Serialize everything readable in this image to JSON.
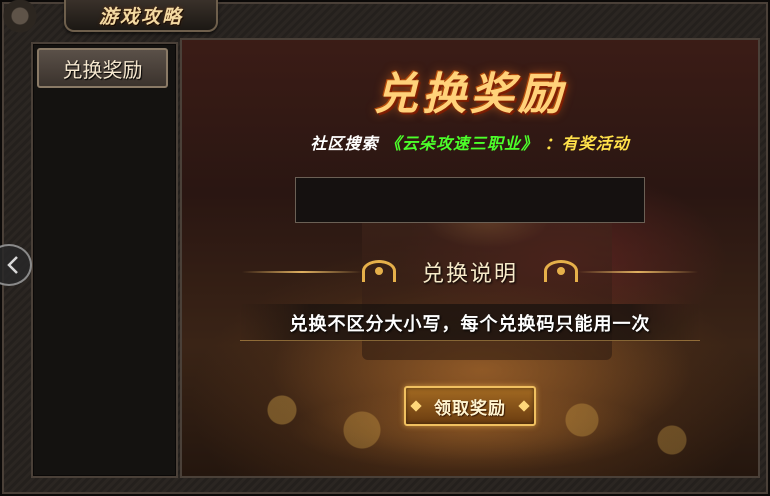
{
  "header": {
    "title": "游戏攻略"
  },
  "sidebar": {
    "tab_label": "兑换奖励"
  },
  "main": {
    "heading": "兑换奖励",
    "hint_prefix": "社区搜索",
    "hint_keyword": "《云朵攻速三职业》",
    "hint_suffix": "：有奖活动",
    "code_input": {
      "value": "",
      "placeholder": ""
    },
    "section_title": "兑换说明",
    "rule_text": "兑换不区分大小写，每个兑换码只能用一次",
    "claim_button": "领取奖励"
  },
  "nav": {
    "prev_icon": "chevron-left-icon"
  },
  "colors": {
    "highlight_green": "#4cff2a",
    "highlight_yellow": "#ffe14a",
    "gold": "#ffd27a"
  }
}
